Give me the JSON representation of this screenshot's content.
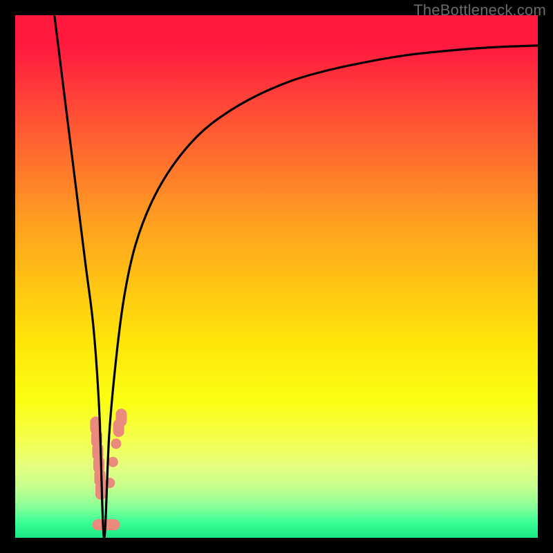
{
  "watermark": "TheBottleneck.com",
  "chart_data": {
    "type": "line",
    "title": "",
    "xlabel": "",
    "ylabel": "",
    "xlim": [
      0,
      100
    ],
    "ylim": [
      0,
      100
    ],
    "grid": false,
    "legend": false,
    "series": [
      {
        "name": "curve",
        "color": "#000000",
        "x": [
          7.5,
          9,
          10.5,
          12,
          13.5,
          15,
          16.1,
          17,
          18,
          19.5,
          21,
          23,
          26,
          30,
          35,
          40,
          46,
          53,
          60,
          68,
          76,
          85,
          92,
          100
        ],
        "y": [
          100,
          88,
          76,
          64,
          52,
          40,
          24,
          0,
          20,
          36,
          47,
          56,
          64,
          71,
          77,
          81,
          84.5,
          87.5,
          89.5,
          91.2,
          92.5,
          93.4,
          93.9,
          94.2
        ]
      }
    ],
    "markers": [
      {
        "name": "scatter-left",
        "color": "#e98a7c",
        "shape": "pill",
        "x": [
          15.4,
          15.6,
          15.8,
          16.0,
          16.2,
          16.4
        ],
        "y": [
          21.5,
          19.0,
          16.5,
          14.0,
          11.5,
          9.0
        ]
      },
      {
        "name": "scatter-right-dots",
        "color": "#e98a7c",
        "shape": "dot",
        "x": [
          18.1,
          18.7,
          19.3
        ],
        "y": [
          10.5,
          14.5,
          18.0
        ]
      },
      {
        "name": "scatter-right-top",
        "color": "#e98a7c",
        "shape": "pill",
        "x": [
          19.8,
          20.3
        ],
        "y": [
          21.0,
          23.0
        ]
      },
      {
        "name": "scatter-bottom",
        "color": "#e98a7c",
        "shape": "pill-horizontal",
        "x": [
          16.6,
          18.2
        ],
        "y": [
          2.5,
          2.5
        ]
      }
    ],
    "gradient_stops": [
      {
        "pos": 0,
        "color": "#ff1a3e"
      },
      {
        "pos": 50,
        "color": "#ffc015"
      },
      {
        "pos": 80,
        "color": "#f3ff55"
      },
      {
        "pos": 100,
        "color": "#18e884"
      }
    ]
  }
}
